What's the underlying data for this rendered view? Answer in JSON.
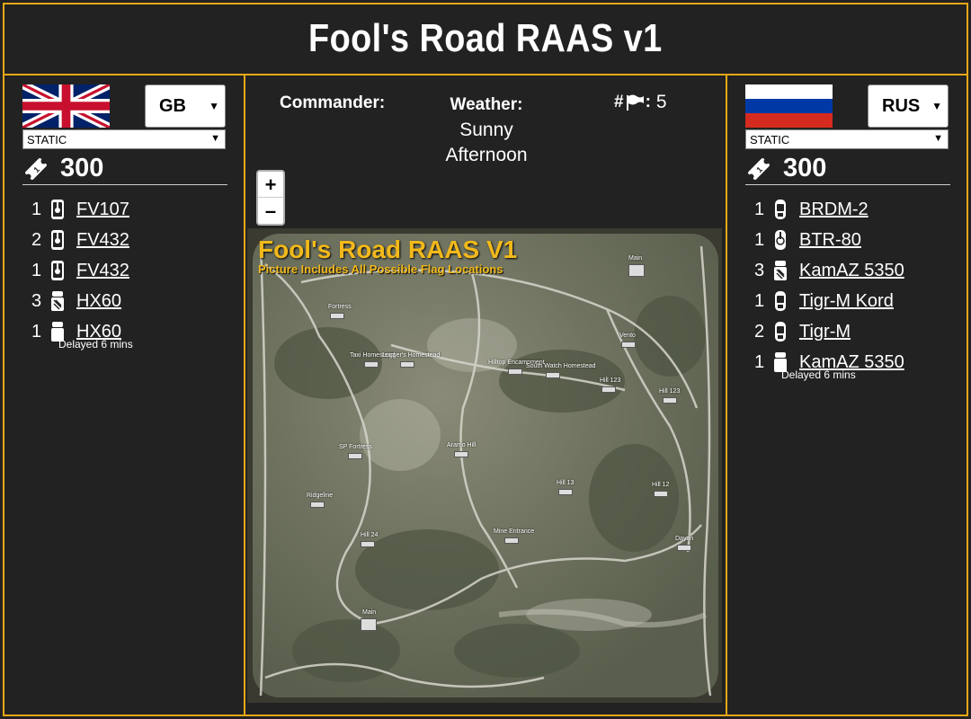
{
  "title": "Fool's Road RAAS v1",
  "accent_color": "#e6a817",
  "left_team": {
    "faction": "GB",
    "mode": "STATIC",
    "tickets": "300",
    "vehicles": [
      {
        "qty": "1",
        "name": "FV107",
        "icon": "tracked-vehicle-icon"
      },
      {
        "qty": "2",
        "name": "FV432",
        "icon": "tracked-vehicle-icon"
      },
      {
        "qty": "1",
        "name": "FV432",
        "icon": "tracked-vehicle-icon"
      },
      {
        "qty": "3",
        "name": "HX60",
        "icon": "logistics-truck-icon"
      },
      {
        "qty": "1",
        "name": "HX60",
        "icon": "transport-truck-icon"
      }
    ],
    "delayed_text": "Delayed 6 mins"
  },
  "right_team": {
    "faction": "RUS",
    "mode": "STATIC",
    "tickets": "300",
    "vehicles": [
      {
        "qty": "1",
        "name": "BRDM-2",
        "icon": "wheeled-vehicle-icon"
      },
      {
        "qty": "1",
        "name": "BTR-80",
        "icon": "wheeled-apc-icon"
      },
      {
        "qty": "3",
        "name": "KamAZ 5350",
        "icon": "logistics-truck-icon"
      },
      {
        "qty": "1",
        "name": "Tigr-M Kord",
        "icon": "wheeled-vehicle-icon"
      },
      {
        "qty": "2",
        "name": "Tigr-M",
        "icon": "wheeled-vehicle-icon"
      },
      {
        "qty": "1",
        "name": "KamAZ 5350",
        "icon": "transport-truck-icon"
      }
    ],
    "delayed_text": "Delayed 6 mins"
  },
  "info": {
    "commander_label": "Commander:",
    "commander_value": "",
    "weather_label": "Weather:",
    "weather_value_line1": "Sunny",
    "weather_value_line2": "Afternoon",
    "flags_prefix": "#",
    "flags_suffix": ":",
    "flags_value": "5"
  },
  "zoom": {
    "in": "+",
    "out": "–"
  },
  "map": {
    "title": "Fool's Road RAAS V1",
    "subtitle": "Picture Includes All Possible Flag Locations",
    "pois": [
      "Main",
      "Fortress",
      "Taxi Homestead",
      "Logger's Homestead",
      "Hilltop Encampment",
      "South Watch Homestead",
      "Vento",
      "Hill 123",
      "Hill 123",
      "SP Fortress",
      "Aramo Hill",
      "Hill 13",
      "Hill 12",
      "Ridgeline",
      "Hill 24",
      "Mine Entrance",
      "Dayan",
      "Main"
    ]
  }
}
